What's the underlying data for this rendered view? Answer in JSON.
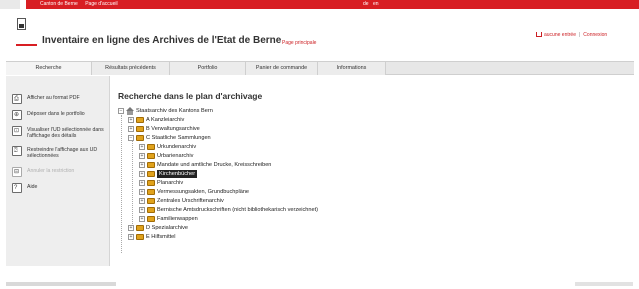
{
  "topbar": {
    "links": [
      "Canton de Berne",
      "Page d'accueil"
    ],
    "languages": [
      "de",
      "en"
    ]
  },
  "header": {
    "title": "Inventaire en ligne des Archives de l'Etat de Berne",
    "page_link": "Page principale",
    "cart_label": "aucune entrée",
    "login_label": "Connexion"
  },
  "tabs": [
    {
      "label": "Recherche"
    },
    {
      "label": "Résultats précédents"
    },
    {
      "label": "Portfolio"
    },
    {
      "label": "Panier de commande"
    },
    {
      "label": "Informations"
    }
  ],
  "sidebar": {
    "items": [
      {
        "label": "Afficher au format PDF",
        "icon": "pdf-icon",
        "glyph": "⎙"
      },
      {
        "label": "Déposer dans le portfolio",
        "icon": "portfolio-icon",
        "glyph": "⊕"
      },
      {
        "label": "Visualiser l'UD sélectionnée dans l'affichage des détails",
        "icon": "details-icon",
        "glyph": "⊡"
      },
      {
        "label": "Restreindre l'affichage aux UD sélectionnées",
        "icon": "restrict-icon",
        "glyph": "⍰"
      },
      {
        "label": "Annuler la restriction",
        "icon": "cancel-restriction-icon",
        "glyph": "⊟"
      },
      {
        "label": "Aide",
        "icon": "help-icon",
        "glyph": "?"
      }
    ]
  },
  "main": {
    "title": "Recherche dans le plan d'archivage",
    "tree": {
      "root": "Staatsarchiv des Kantons Bern",
      "items": [
        {
          "label": "A Kanzleiarchiv"
        },
        {
          "label": "B Verwaltungsarchive"
        },
        {
          "label": "C Staatliche Sammlungen"
        },
        {
          "label": "Urkundenarchiv"
        },
        {
          "label": "Urbarienarchiv"
        },
        {
          "label": "Mandate und amtliche Drucke, Kreisschreiben"
        },
        {
          "label": "Kirchenbücher"
        },
        {
          "label": "Planarchiv"
        },
        {
          "label": "Vermessungsakten, Grundbuchpläne"
        },
        {
          "label": "Zentrales Urschriftenarchiv"
        },
        {
          "label": "Bernische Amtsdruckschriften (nicht bibliothekarisch verzeichnet)"
        },
        {
          "label": "Familienwappen"
        },
        {
          "label": "D Spezialarchive"
        },
        {
          "label": "E Hilfsmittel"
        }
      ]
    }
  },
  "colors": {
    "accent": "#d81e23",
    "folder": "#e0a21c",
    "selected_bg": "#222222"
  }
}
